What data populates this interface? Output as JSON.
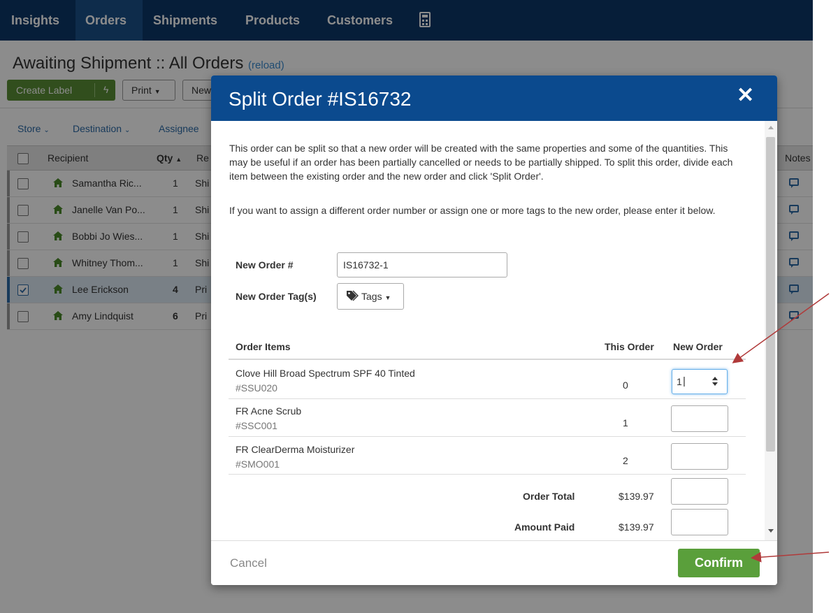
{
  "nav": {
    "items": [
      "Insights",
      "Orders",
      "Shipments",
      "Products",
      "Customers"
    ],
    "active": "Orders",
    "calculator_icon": "calculator-icon"
  },
  "page": {
    "title": "Awaiting Shipment :: All Orders",
    "reload": "(reload)"
  },
  "toolbar": {
    "create_label": "Create Label",
    "print": "Print",
    "new": "New"
  },
  "filters": [
    "Store",
    "Destination",
    "Assignee"
  ],
  "table": {
    "headers": {
      "recipient": "Recipient",
      "qty": "Qty",
      "requested": "Re",
      "notes": "Notes"
    },
    "rows": [
      {
        "name": "Samantha Ric...",
        "qty": "1",
        "service": "Shi",
        "selected": false
      },
      {
        "name": "Janelle Van Po...",
        "qty": "1",
        "service": "Shi",
        "selected": false
      },
      {
        "name": "Bobbi Jo Wies...",
        "qty": "1",
        "service": "Shi",
        "selected": false
      },
      {
        "name": "Whitney Thom...",
        "qty": "1",
        "service": "Shi",
        "selected": false
      },
      {
        "name": "Lee Erickson",
        "qty": "4",
        "service": "Pri",
        "selected": true
      },
      {
        "name": "Amy Lindquist",
        "qty": "6",
        "service": "Pri",
        "selected": false
      }
    ]
  },
  "modal": {
    "title": "Split Order #IS16732",
    "close": "✕",
    "intro": "This order can be split so that a new order will be created with the same properties and some of the quantities. This may be useful if an order has been partially cancelled or needs to be partially shipped. To split this order, divide each item between the existing order and the new order and click 'Split Order'.",
    "assign_note": "If you want to assign a different order number or assign one or more tags to the new order, please enter it below.",
    "new_order_label": "New Order #",
    "new_order_value": "IS16732-1",
    "tags_label": "New Order Tag(s)",
    "tags_button": "Tags",
    "columns": {
      "items": "Order Items",
      "this_order": "This Order",
      "new_order": "New Order"
    },
    "items": [
      {
        "name": "Clove Hill Broad Spectrum SPF 40 Tinted",
        "sku": "#SSU020",
        "this_order": "0",
        "new_order": "1"
      },
      {
        "name": "FR Acne Scrub",
        "sku": "#SSC001",
        "this_order": "1",
        "new_order": ""
      },
      {
        "name": "FR ClearDerma Moisturizer",
        "sku": "#SMO001",
        "this_order": "2",
        "new_order": ""
      }
    ],
    "totals": [
      {
        "label": "Order Total",
        "value": "$139.97"
      },
      {
        "label": "Amount Paid",
        "value": "$139.97"
      }
    ],
    "cancel": "Cancel",
    "confirm": "Confirm"
  },
  "colors": {
    "nav_bg": "#0b3868",
    "modal_header": "#0b4a8e",
    "confirm_green": "#5a9f3b",
    "annotation_arrow": "#b03a3a"
  }
}
